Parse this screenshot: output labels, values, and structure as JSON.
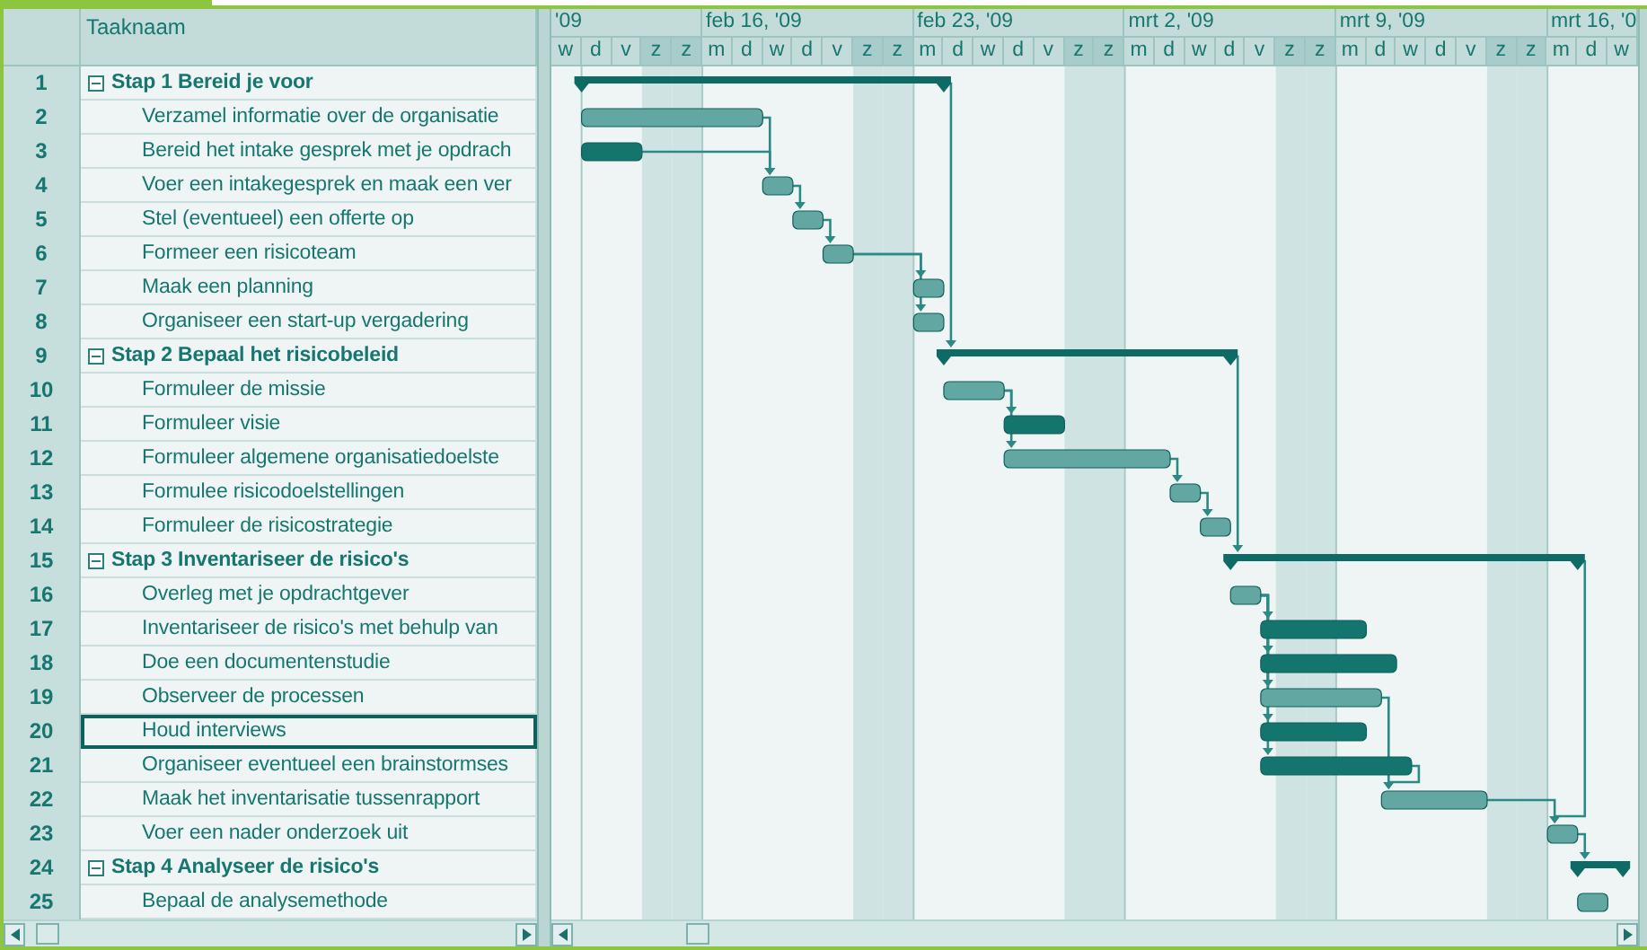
{
  "task_table": {
    "header": "Taaknaam",
    "tasks": [
      {
        "number": "1",
        "name": "Stap 1 Bereid je voor",
        "kind": "summary",
        "expanded": true,
        "selected": false
      },
      {
        "number": "2",
        "name": "Verzamel informatie over de organisatie",
        "kind": "normal",
        "selected": false
      },
      {
        "number": "3",
        "name": "Bereid het intake gesprek met je opdrach",
        "kind": "critical",
        "selected": false
      },
      {
        "number": "4",
        "name": "Voer een intakegesprek en maak een ver",
        "kind": "normal",
        "selected": false
      },
      {
        "number": "5",
        "name": "Stel (eventueel) een offerte op",
        "kind": "normal",
        "selected": false
      },
      {
        "number": "6",
        "name": "Formeer een risicoteam",
        "kind": "normal",
        "selected": false
      },
      {
        "number": "7",
        "name": "Maak een planning",
        "kind": "normal",
        "selected": false
      },
      {
        "number": "8",
        "name": "Organiseer een start-up vergadering",
        "kind": "normal",
        "selected": false
      },
      {
        "number": "9",
        "name": "Stap 2 Bepaal het risicobeleid",
        "kind": "summary",
        "expanded": true,
        "selected": false
      },
      {
        "number": "10",
        "name": "Formuleer de missie",
        "kind": "normal",
        "selected": false
      },
      {
        "number": "11",
        "name": "Formuleer visie",
        "kind": "critical",
        "selected": false
      },
      {
        "number": "12",
        "name": "Formuleer algemene organisatiedoelste",
        "kind": "normal",
        "selected": false
      },
      {
        "number": "13",
        "name": "Formulee risicodoelstellingen",
        "kind": "normal",
        "selected": false
      },
      {
        "number": "14",
        "name": "Formuleer de risicostrategie",
        "kind": "normal",
        "selected": false
      },
      {
        "number": "15",
        "name": "Stap 3 Inventariseer de risico's",
        "kind": "summary",
        "expanded": true,
        "selected": false
      },
      {
        "number": "16",
        "name": "Overleg met je opdrachtgever",
        "kind": "normal",
        "selected": false
      },
      {
        "number": "17",
        "name": "Inventariseer de risico's met behulp van",
        "kind": "critical",
        "selected": false
      },
      {
        "number": "18",
        "name": "Doe een documentenstudie",
        "kind": "critical",
        "selected": false
      },
      {
        "number": "19",
        "name": "Observeer de processen",
        "kind": "normal",
        "selected": false
      },
      {
        "number": "20",
        "name": "Houd interviews",
        "kind": "critical",
        "selected": true
      },
      {
        "number": "21",
        "name": "Organiseer eventueel een brainstormses",
        "kind": "critical",
        "selected": false
      },
      {
        "number": "22",
        "name": "Maak het inventarisatie tussenrapport",
        "kind": "normal",
        "selected": false
      },
      {
        "number": "23",
        "name": "Voer een nader onderzoek uit",
        "kind": "normal",
        "selected": false
      },
      {
        "number": "24",
        "name": "Stap 4 Analyseer de risico's",
        "kind": "summary",
        "expanded": true,
        "selected": false
      },
      {
        "number": "25",
        "name": "Bepaal de analysemethode",
        "kind": "normal",
        "selected": false
      }
    ]
  },
  "timeline": {
    "weeks": [
      "'09",
      "feb 16, '09",
      "feb 23, '09",
      "mrt 2, '09",
      "mrt 9, '09",
      "mrt 16, '0"
    ],
    "days": [
      {
        "label": "w",
        "weekend": false
      },
      {
        "label": "d",
        "weekend": false
      },
      {
        "label": "v",
        "weekend": false
      },
      {
        "label": "z",
        "weekend": true
      },
      {
        "label": "z",
        "weekend": true
      },
      {
        "label": "m",
        "weekend": false
      },
      {
        "label": "d",
        "weekend": false
      },
      {
        "label": "w",
        "weekend": false
      },
      {
        "label": "d",
        "weekend": false
      },
      {
        "label": "v",
        "weekend": false
      },
      {
        "label": "z",
        "weekend": true
      },
      {
        "label": "z",
        "weekend": true
      },
      {
        "label": "m",
        "weekend": false
      },
      {
        "label": "d",
        "weekend": false
      },
      {
        "label": "w",
        "weekend": false
      },
      {
        "label": "d",
        "weekend": false
      },
      {
        "label": "v",
        "weekend": false
      },
      {
        "label": "z",
        "weekend": true
      },
      {
        "label": "z",
        "weekend": true
      },
      {
        "label": "m",
        "weekend": false
      },
      {
        "label": "d",
        "weekend": false
      },
      {
        "label": "w",
        "weekend": false
      },
      {
        "label": "d",
        "weekend": false
      },
      {
        "label": "v",
        "weekend": false
      },
      {
        "label": "z",
        "weekend": true
      },
      {
        "label": "z",
        "weekend": true
      },
      {
        "label": "m",
        "weekend": false
      },
      {
        "label": "d",
        "weekend": false
      },
      {
        "label": "w",
        "weekend": false
      },
      {
        "label": "d",
        "weekend": false
      },
      {
        "label": "v",
        "weekend": false
      },
      {
        "label": "z",
        "weekend": true
      },
      {
        "label": "z",
        "weekend": true
      },
      {
        "label": "m",
        "weekend": false
      },
      {
        "label": "d",
        "weekend": false
      },
      {
        "label": "w",
        "weekend": false
      }
    ]
  }
}
